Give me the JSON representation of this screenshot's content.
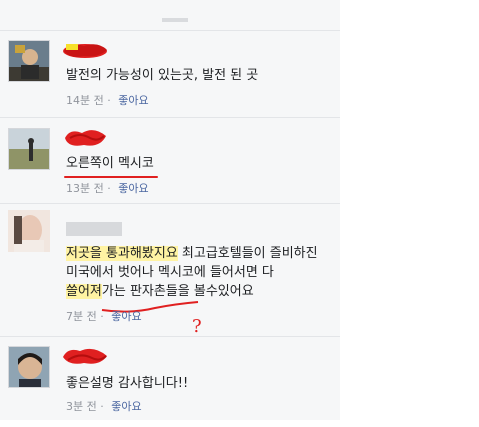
{
  "comments": [
    {
      "text_lines": [
        "발전의 가능성이 있는곳, 발전 된 곳"
      ],
      "time": "14분 전",
      "separator": "·",
      "like_label": "좋아요"
    },
    {
      "text_lines": [
        "오른쪽이 멕시코"
      ],
      "time": "13분 전",
      "separator": "·",
      "like_label": "좋아요"
    },
    {
      "text_segments": {
        "line1_highlight": "저곳을 통과해봤지요",
        "line1_rest": " 최고급호텔들이 즐비하진",
        "line2": "미국에서 벗어나 멕시코에 들어서면 다",
        "line3_highlight": "쓸어져",
        "line3_rest": "가는 판자촌들을 볼수있어요"
      },
      "question_mark": "?",
      "time": "7분 전",
      "separator": "·",
      "like_label": "좋아요"
    },
    {
      "text_lines": [
        "좋은설명 감사합니다!!"
      ],
      "time": "3분 전",
      "separator": "·",
      "like_label": "좋아요"
    }
  ],
  "colors": {
    "panel_bg": "#f6f7f8",
    "text": "#1c1e21",
    "meta": "#90949c",
    "like": "#4b67a1",
    "highlight": "#fff3a3",
    "scribble_red": "#e02020"
  }
}
